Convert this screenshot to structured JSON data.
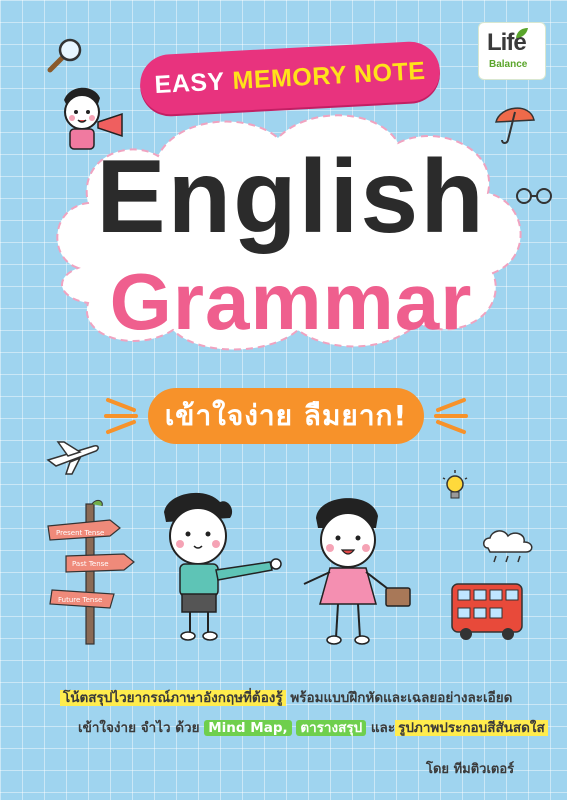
{
  "publisher": {
    "logo_main": "Life",
    "logo_sub": "Balance"
  },
  "banner": {
    "part1": "EASY",
    "part2": "MEMORY NOTE"
  },
  "title": {
    "line1": "English",
    "line2": "Grammar"
  },
  "subtitle": "เข้าใจง่าย ลืมยาก!",
  "signpost": {
    "sign1": "Present Tense",
    "sign2": "Past Tense",
    "sign3": "Future Tense"
  },
  "description": {
    "line1_highlight": "โน้ตสรุปไวยากรณ์ภาษาอังกฤษที่ต้องรู้",
    "line1_rest": " พร้อมแบบฝึกหัดและเฉลยอย่างละเอียด",
    "line2_a": "เข้าใจง่าย จำไว ด้วย ",
    "line2_tag1": "Mind Map,",
    "line2_tag2": "ตารางสรุป",
    "line2_b": " และ",
    "line2_highlight": "รูปภาพประกอบสีสันสดใส"
  },
  "author": {
    "prefix": "โดย",
    "name": "ทีมติวเตอร์"
  },
  "colors": {
    "background": "#9fd4ef",
    "banner": "#e8337e",
    "grammar": "#ef5f8e",
    "pill": "#f7922a",
    "highlight": "#ffec4d",
    "tag": "#6fcf4d"
  }
}
